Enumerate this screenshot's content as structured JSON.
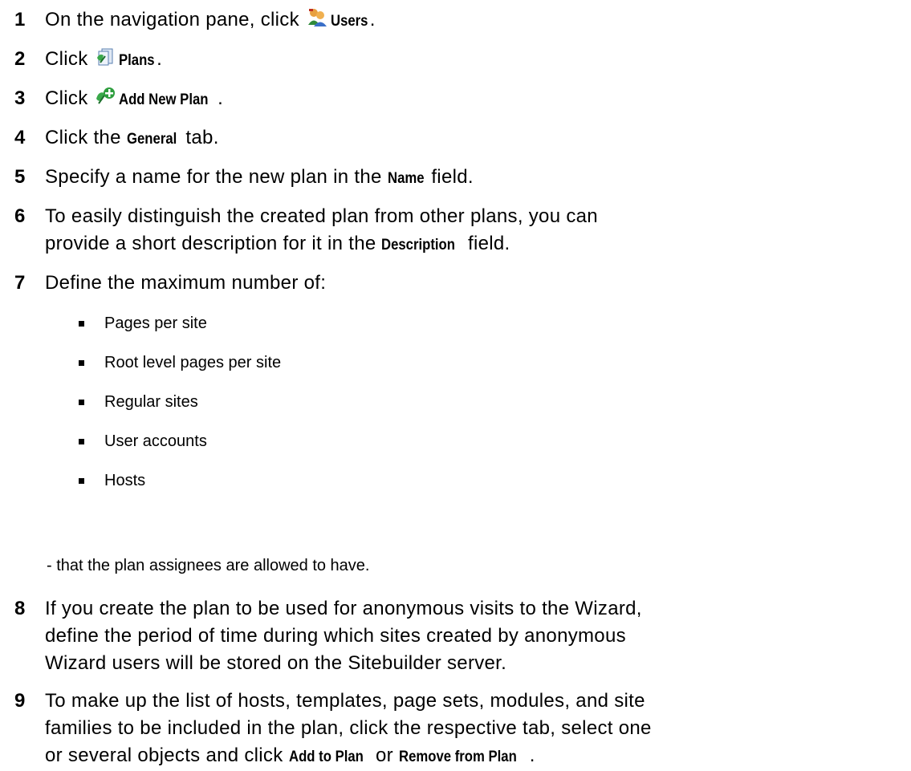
{
  "steps": [
    {
      "num": "1",
      "before": "On the navigation pane, click ",
      "icon": "users-icon",
      "ui": "Users",
      "after": "."
    },
    {
      "num": "2",
      "before": "Click ",
      "icon": "plans-icon",
      "ui": "Plans",
      "after": "."
    },
    {
      "num": "3",
      "before": "Click ",
      "icon": "add-plan-icon",
      "ui": "Add New Plan",
      "after": "."
    },
    {
      "num": "4",
      "before": "Click the ",
      "ui": "General",
      "after": " tab."
    },
    {
      "num": "5",
      "before": "Specify a name for the new plan in the ",
      "ui": "Name",
      "after": " field."
    },
    {
      "num": "6",
      "line1": "To easily distinguish the created plan from other plans, you can",
      "line2_before": "provide a short description for it in the ",
      "ui": "Description",
      "after": " field."
    },
    {
      "num": "7",
      "text": "Define the maximum number of:"
    },
    {
      "num": "8",
      "lines": [
        "If you create the plan to be used for anonymous visits to the Wizard,",
        "define the period of time during which sites created by anonymous",
        "Wizard users will be stored on the Sitebuilder server."
      ]
    },
    {
      "num": "9",
      "line1": "To make up the list of hosts, templates, page sets, modules, and site",
      "line2": "families to be included in the plan, click the respective tab, select one",
      "line3_before": "or several objects and click ",
      "ui1": "Add to Plan",
      "mid": " or ",
      "ui2": "Remove from Plan",
      "after": "."
    }
  ],
  "bullets": [
    "Pages per site",
    "Root level pages per site",
    "Regular sites",
    "User accounts",
    "Hosts"
  ],
  "tail": "- that the plan assignees are allowed to have."
}
